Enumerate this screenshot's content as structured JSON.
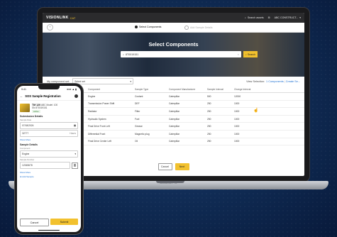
{
  "laptop": {
    "brand": "VISIONLINK",
    "brand_sub": "CAT",
    "topbar": {
      "search_label": "Search assets",
      "account_label": "ABC CONSTRUCT..."
    },
    "base_brand": "MacBook Pro",
    "steps": {
      "step1": "Select Components",
      "step2": "Add Sample Details"
    },
    "hero": {
      "title": "Select Components",
      "search_value": "8T0019151",
      "search_button": "Search"
    },
    "component_set": {
      "label": "My component set:",
      "select_placeholder": "Select set",
      "view_selection_label": "View Selection:",
      "view_selection_value": "1 Components",
      "create_link": "Create Se..."
    },
    "table": {
      "headers": [
        "",
        "Asset",
        "Component",
        "Sample Type",
        "Component Manufacturer",
        "Sample Interval",
        "Change Interval"
      ],
      "rows": [
        {
          "asset": "2 SN 8T0019151",
          "asset2": "...CAT 320 0384",
          "component": "Engine",
          "type": "Coolant",
          "mfr": "Caterpillar",
          "sample": "500",
          "change": "12000"
        },
        {
          "asset": "",
          "asset2": "...CAT 320 0384",
          "component": "Transmission Power Shift",
          "type": "DEF",
          "mfr": "Caterpillar",
          "sample": "250",
          "change": "1000"
        },
        {
          "asset": "",
          "asset2": "...CAT 320 0384",
          "component": "Radiator",
          "type": "Filter",
          "mfr": "Caterpillar",
          "sample": "250",
          "change": "1000"
        },
        {
          "asset": "",
          "asset2": "...CAT 320 0384",
          "component": "Hydraulic System",
          "type": "Fuel",
          "mfr": "Caterpillar",
          "sample": "250",
          "change": "1000"
        },
        {
          "asset": "",
          "asset2": "...CAT 320 0384",
          "component": "Final Drive Front Left",
          "type": "Grease",
          "mfr": "Caterpillar",
          "sample": "250",
          "change": "1000"
        },
        {
          "asset": "",
          "asset2": "...CAT 320 0384",
          "component": "Differential Front",
          "type": "Magnetic plug",
          "mfr": "Caterpillar",
          "sample": "250",
          "change": "1000"
        },
        {
          "asset": "",
          "asset2": "...CAT 320 0384",
          "component": "Final Drive Center Left",
          "type": "Oil",
          "mfr": "Caterpillar",
          "sample": "250",
          "change": "1000"
        }
      ]
    },
    "footer": {
      "cancel": "Cancel",
      "next": "Next"
    }
  },
  "phone": {
    "status_time": "9:41",
    "status_right": "●●● ▲ ▮",
    "header_title": "SOS Sample Registration",
    "asset": {
      "title": "TM 120",
      "subtitle": "ABC Model: 100",
      "line1": "SN 8T0019151",
      "badge": "Active"
    },
    "submission_label": "Submission Details",
    "fields": {
      "date_label": "Sample Date",
      "date_value": "07/18/2024",
      "hours_value": "32777",
      "hours_unit": "Hours",
      "show_more": "Show More",
      "sample_details_label": "Sample Details",
      "component_label": "Component",
      "component_value": "Engine",
      "sample_number_label": "Sample Number",
      "sample_number_value": "12345678",
      "add_sample": "Add Sample"
    },
    "buttons": {
      "cancel": "Cancel",
      "submit": "Submit"
    }
  },
  "colors": {
    "accent": "#f2c12e",
    "background": "#0f2a52",
    "link": "#1b6fd1"
  }
}
